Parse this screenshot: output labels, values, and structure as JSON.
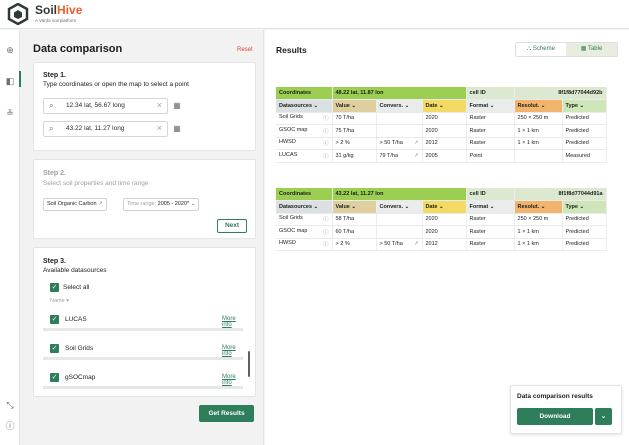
{
  "brand": {
    "name1": "Soil",
    "name2": "Hive",
    "tagline": "A Varda soil platform"
  },
  "left": {
    "title": "Data comparison",
    "reset": "Reset",
    "step1": {
      "title": "Step 1.",
      "subtitle": "Type coordinates or open the map to select a point",
      "inputs": [
        "12.34 lat, 56.67 long",
        "43.22 lat, 11.27 long"
      ]
    },
    "step2": {
      "title": "Step 2.",
      "subtitle": "Select soil properties and time range",
      "chip1": "Soil Organic Carbon",
      "chip2_label": "Time range: ",
      "chip2_value": "2005 - 2020*",
      "next": "Next"
    },
    "step3": {
      "title": "Step 3.",
      "subtitle": "Available datasources",
      "select_all": "Select all",
      "name_header": "Name",
      "more": "More info",
      "sources": [
        "LUCAS",
        "Soil Grids",
        "gSOCmap"
      ]
    },
    "get_results": "Get Results"
  },
  "right": {
    "title": "Results",
    "scheme": "Scheme",
    "table": "Table",
    "tables": [
      {
        "coord_label": "Coordinates",
        "coord": "48.22 lat, 11.87 lon",
        "cell_label": "cell ID",
        "cell": "8f1f8d77044d92b",
        "headers": [
          "Datasources",
          "Value",
          "Convers.",
          "Date",
          "Format",
          "Resolut.",
          "Type"
        ],
        "rows": [
          [
            "Soil Grids",
            "70 T/ha",
            "",
            "2020",
            "Raster",
            "250 × 250 m",
            "Predicted"
          ],
          [
            "GSOC map",
            "75 T/ha",
            "",
            "2020",
            "Raster",
            "1 × 1 km",
            "Predicted"
          ],
          [
            "HWSD",
            "> 2 %",
            "> 50 T/ha",
            "2012",
            "Raster",
            "1 × 1 km",
            "Predicted"
          ],
          [
            "LUCAS",
            "31 g/kg",
            "79 T/ha",
            "2005",
            "Point",
            "",
            "Measured"
          ]
        ]
      },
      {
        "coord_label": "Coordinates",
        "coord": "43.22 lat, 11.27 lon",
        "cell_label": "cell ID",
        "cell": "8f1f8d77044d91a",
        "headers": [
          "Datasources",
          "Value",
          "Convers.",
          "Date",
          "Format",
          "Resolut.",
          "Type"
        ],
        "rows": [
          [
            "Soil Grids",
            "58 T/ha",
            "",
            "2020",
            "Raster",
            "250 × 250 m",
            "Predicted"
          ],
          [
            "GSOC map",
            "60 T/ha",
            "",
            "2020",
            "Raster",
            "1 × 1 km",
            "Predicted"
          ],
          [
            "HWSD",
            "> 2 %",
            "> 50 T/ha",
            "2012",
            "Raster",
            "1 × 1 km",
            "Predicted"
          ]
        ]
      }
    ],
    "download": {
      "title": "Data comparison results",
      "button": "Download"
    }
  }
}
